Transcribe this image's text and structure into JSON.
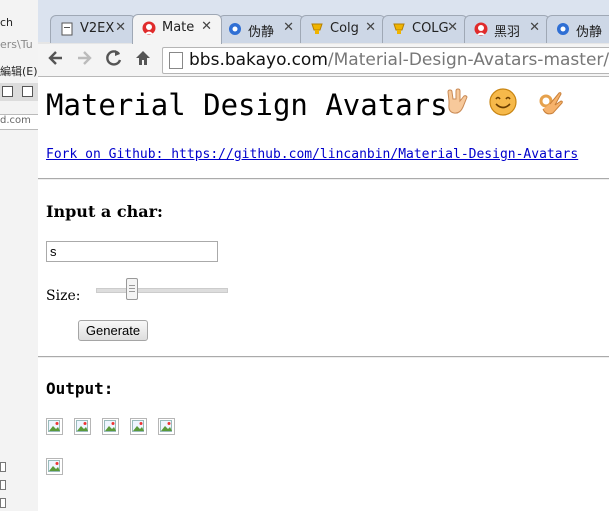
{
  "background_window": {
    "lines": [
      "ch",
      "ers\\Tu",
      "編辑(E)",
      "d.com"
    ]
  },
  "tabs": [
    {
      "title": "V2EX",
      "icon": "page-icon",
      "active": false
    },
    {
      "title": "Mate",
      "icon": "red-avatar-icon",
      "active": true
    },
    {
      "title": "伪静",
      "icon": "blue-gear-icon",
      "active": false
    },
    {
      "title": "Colg",
      "icon": "trophy-icon",
      "active": false
    },
    {
      "title": "COLG",
      "icon": "trophy-icon",
      "active": false
    },
    {
      "title": "黑羽",
      "icon": "red-avatar-icon",
      "active": false
    },
    {
      "title": "伪静",
      "icon": "blue-gear-icon",
      "active": false
    }
  ],
  "toolbar": {
    "url_host": "bbs.bakayo.com",
    "url_path": "/Material-Design-Avatars-master/demo"
  },
  "page": {
    "title": "Material Design Avatars",
    "fork_link": "Fork on Github: https://github.com/lincanbin/Material-Design-Avatars",
    "input_label": "Input a char:",
    "char_value": "s",
    "size_label": "Size:",
    "size_slider_fraction": 0.25,
    "generate_label": "Generate",
    "output_label": "Output:",
    "emoji_icons": [
      "rock-hand-emoji-icon",
      "smiley-emoji-icon",
      "ok-hand-emoji-icon"
    ],
    "output_image_count": 6
  },
  "colors": {
    "link": "#0000cc",
    "tab_active": "#f4f4f4",
    "tab_inactive": "#cdd7e6"
  }
}
